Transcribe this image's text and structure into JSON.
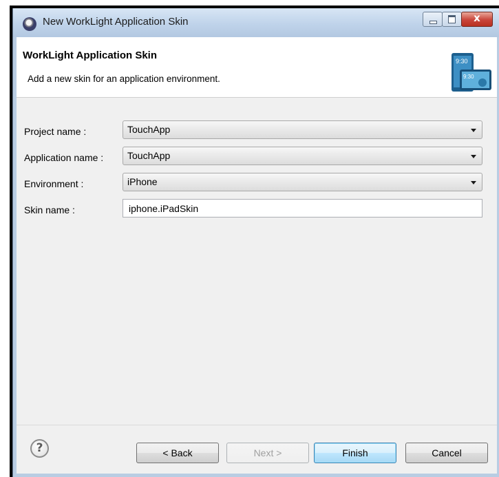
{
  "window": {
    "title": "New WorkLight Application Skin",
    "close_glyph": "x"
  },
  "header": {
    "title": "WorkLight Application Skin",
    "description": "Add a new skin for an application environment.",
    "graphic_time_1": "9:30",
    "graphic_time_2": "9:30"
  },
  "form": {
    "project_label": "Project name :",
    "project_value": "TouchApp",
    "application_label": "Application name :",
    "application_value": "TouchApp",
    "environment_label": "Environment :",
    "environment_value": "iPhone",
    "skin_label": "Skin name :",
    "skin_value": "iphone.iPadSkin"
  },
  "footer": {
    "help_glyph": "?",
    "back_label": "< Back",
    "next_label": "Next >",
    "finish_label": "Finish",
    "cancel_label": "Cancel"
  }
}
